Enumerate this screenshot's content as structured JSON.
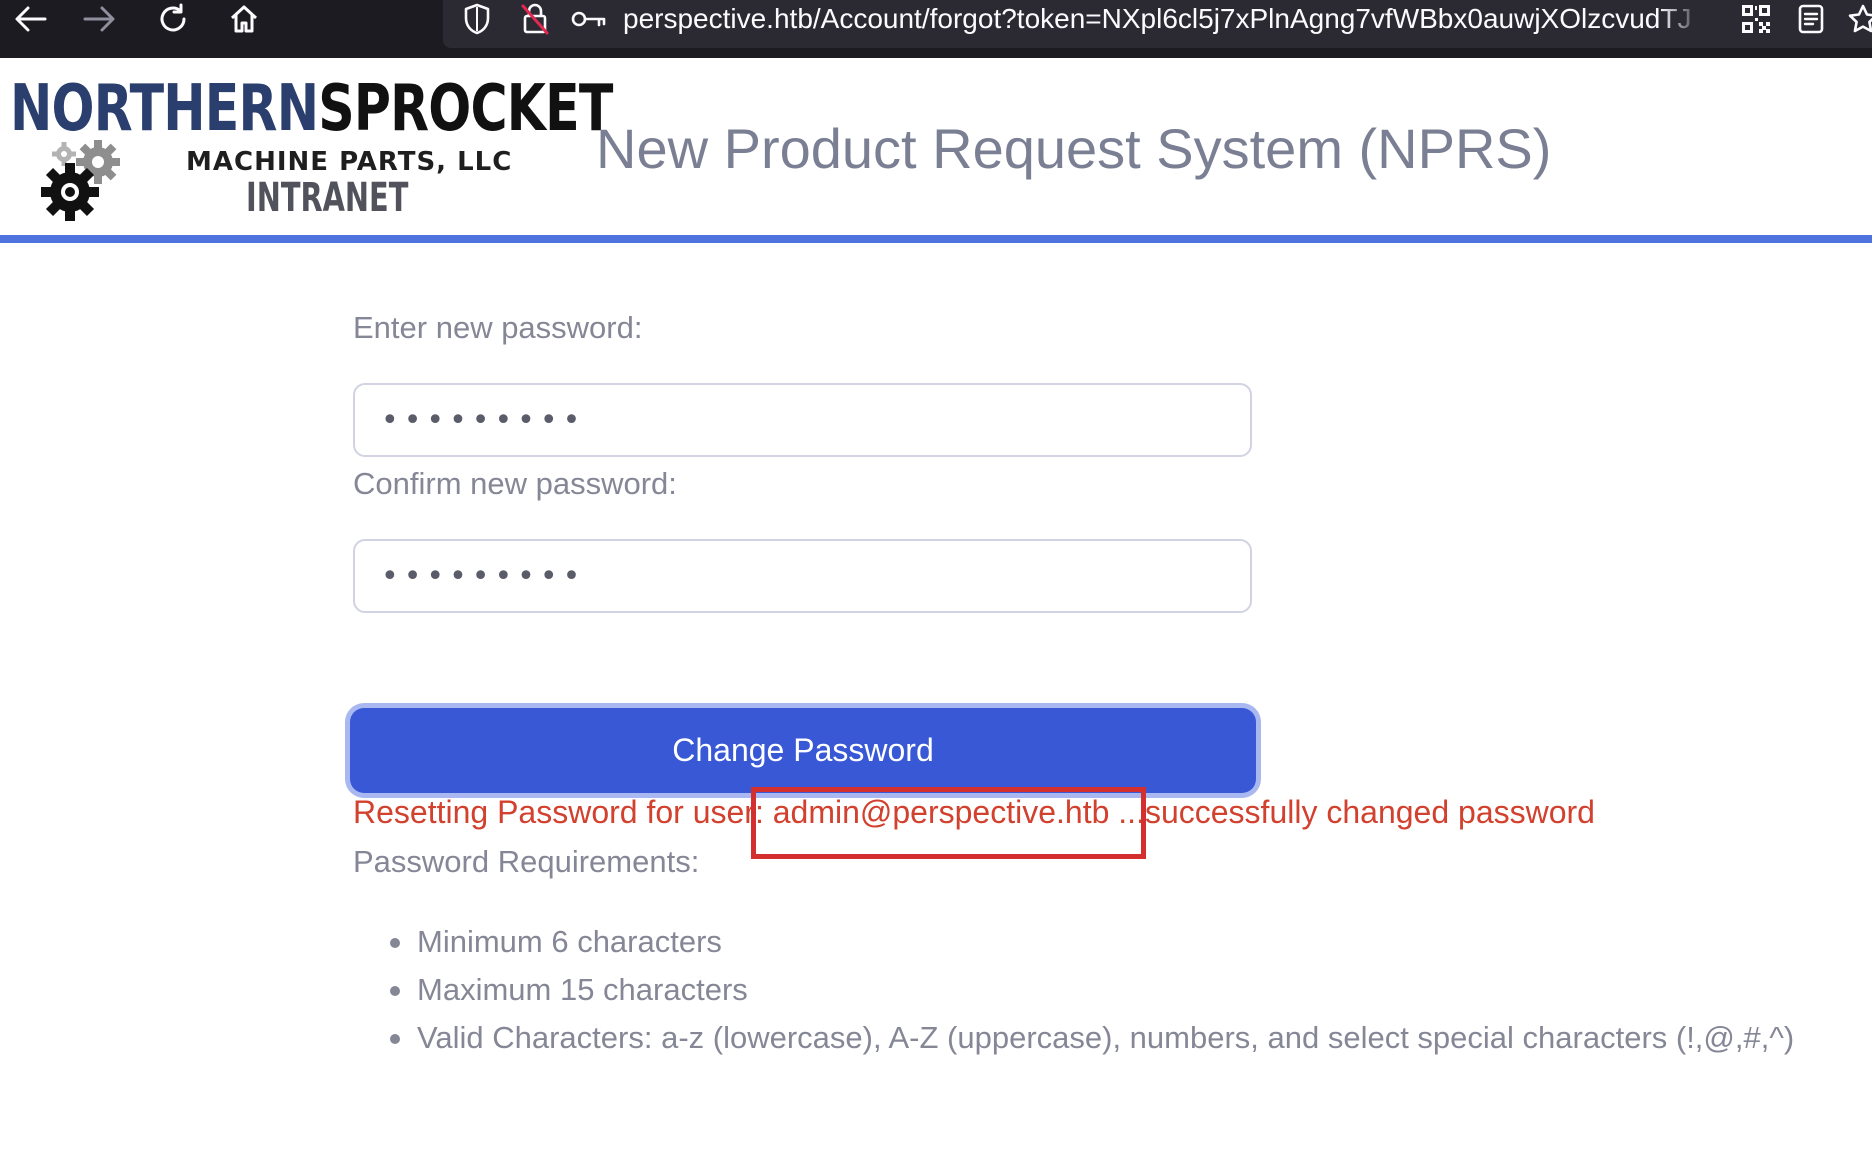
{
  "browser": {
    "url": "perspective.htb/Account/forgot?token=NXpl6cl5j7xPlnAgng7vfWBbx0auwjXOlzcvudTJ",
    "icons": [
      "back-arrow-icon",
      "forward-arrow-icon",
      "reload-icon",
      "home-icon",
      "shield-icon",
      "lock-off-icon",
      "key-icon",
      "qr-code-icon",
      "reader-view-icon",
      "bookmark-star-icon"
    ]
  },
  "header": {
    "logo": {
      "top_first": "NORTHERN",
      "top_second": "SPROCKET",
      "middle": "MACHINE PARTS, LLC",
      "bottom": "INTRANET"
    },
    "title": "New Product Request System (NPRS)",
    "accent_color": "#4e73df"
  },
  "form": {
    "new_password_label": "Enter new password:",
    "new_password_value": "•••••••••",
    "confirm_password_label": "Confirm new password:",
    "confirm_password_value": "•••••••••",
    "submit_label": "Change Password",
    "button_color": "#3858d6"
  },
  "status": {
    "message": "Resetting Password for user: admin@perspective.htb ...successfully changed password",
    "color": "#d2402e"
  },
  "requirements": {
    "title": "Password Requirements:",
    "items": [
      "Minimum 6 characters",
      "Maximum 15 characters",
      "Valid Characters: a-z (lowercase), A-Z (uppercase), numbers, and select special characters (!,@,#,^)"
    ]
  }
}
